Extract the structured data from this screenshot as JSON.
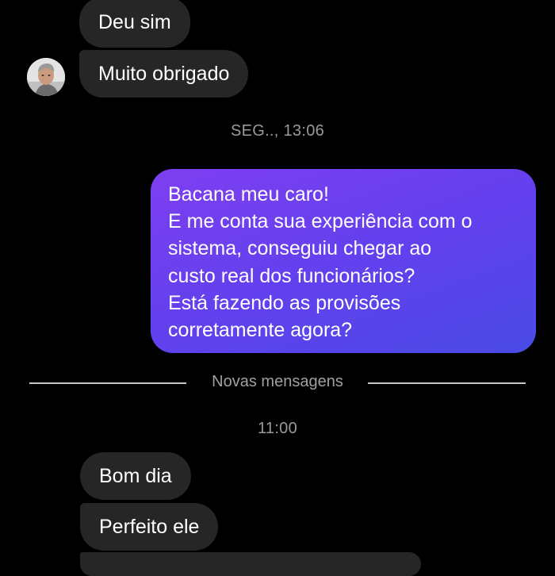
{
  "messages": {
    "m1": "Deu sim",
    "m2": "Muito obrigado",
    "m3": "Bom dia",
    "m4": "Perfeito ele"
  },
  "timestamps": {
    "t1": "SEG.., 13:06",
    "t2": "11:00"
  },
  "outgoing": {
    "lines": [
      "Bacana meu caro!",
      "E me conta sua experiência com o",
      "sistema, conseguiu chegar ao",
      "custo real dos funcionários?",
      "Está fazendo as provisões",
      "corretamente agora?"
    ]
  },
  "divider": {
    "label": "Novas mensagens"
  },
  "colors": {
    "background": "#000000",
    "incoming_bubble": "#262626",
    "outgoing_gradient_start": "#7e3ff0",
    "outgoing_gradient_end": "#4a4be6",
    "timestamp_text": "#9a9a9a"
  },
  "icons": {
    "avatar": "user-avatar-photo"
  }
}
